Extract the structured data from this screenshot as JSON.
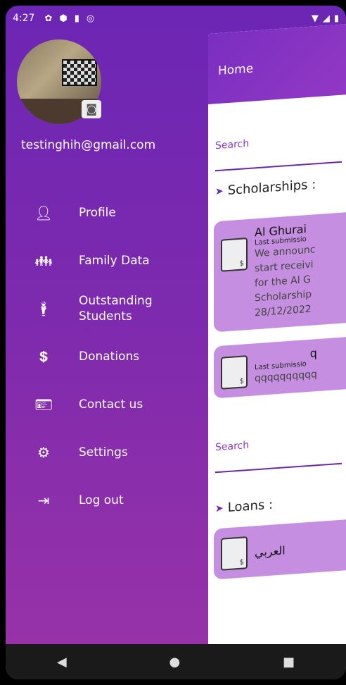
{
  "status_bar": {
    "time": "4:27",
    "icons": [
      "gear-icon",
      "shield-icon",
      "sim-icon",
      "sync-icon"
    ],
    "right_icons": [
      "wifi-icon",
      "signal-icon",
      "battery-icon"
    ]
  },
  "main": {
    "header_title": "Home",
    "search1_label": "Search",
    "scholarships_title": "Scholarships :",
    "cards": [
      {
        "title": "Al Ghurai",
        "subtitle": "Last submissio",
        "desc": [
          "We announc",
          "start receivi",
          "for the Al G",
          "Scholarship",
          "28/12/2022"
        ]
      },
      {
        "title": "q",
        "subtitle": "Last submissio",
        "desc": [
          "qqqqqqqqqq"
        ]
      }
    ],
    "search2_label": "Search",
    "loans_title": "Loans :",
    "loan_card_title": "العربي"
  },
  "drawer": {
    "email": "testinghih@gmail.com",
    "menu": [
      {
        "icon": "person-icon",
        "label": "Profile"
      },
      {
        "icon": "family-icon",
        "label": "Family Data"
      },
      {
        "icon": "student-icon",
        "label": "Outstanding Students"
      },
      {
        "icon": "donation-icon",
        "label": "Donations"
      },
      {
        "icon": "contact-card-icon",
        "label": "Contact us"
      },
      {
        "icon": "gear-icon",
        "label": "Settings"
      },
      {
        "icon": "logout-icon",
        "label": "Log out"
      }
    ]
  },
  "colors": {
    "drawer_top": "#6c26b4",
    "drawer_bottom": "#9a33a8",
    "card_bg": "#c58ee0"
  }
}
